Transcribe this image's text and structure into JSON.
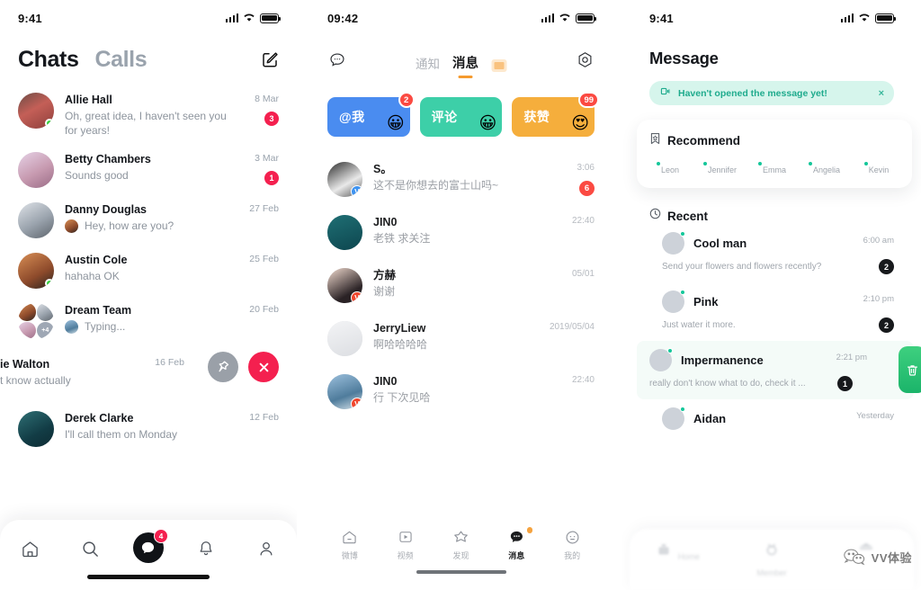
{
  "panel1": {
    "status": {
      "time": "9:41"
    },
    "tabs": [
      {
        "label": "Chats",
        "active": true
      },
      {
        "label": "Calls",
        "active": false
      }
    ],
    "compose_icon": "compose-icon",
    "chats": [
      {
        "name": "Allie Hall",
        "message": "Oh, great idea, I haven't seen you for years!",
        "time": "8 Mar",
        "badge": "3",
        "online": true
      },
      {
        "name": "Betty Chambers",
        "message": "Sounds good",
        "time": "3 Mar",
        "badge": "1",
        "online": false
      },
      {
        "name": "Danny Douglas",
        "message": "Hey, how are you?",
        "time": "27 Feb",
        "badge": "",
        "online": false,
        "mini_avatar": true
      },
      {
        "name": "Austin Cole",
        "message": "hahaha OK",
        "time": "25 Feb",
        "badge": "",
        "online": true
      },
      {
        "name": "Dream Team",
        "message": "Typing...",
        "time": "20 Feb",
        "badge": "",
        "online": false,
        "mini_avatar": true,
        "group": true,
        "group_more": "+4"
      },
      {
        "name": "ie Walton",
        "message": "t know actually",
        "time": "16 Feb",
        "badge": "",
        "swiped": true
      },
      {
        "name": "Derek Clarke",
        "message": "I'll call them on Monday",
        "time": "12 Feb",
        "badge": "",
        "online": false
      }
    ],
    "swipe_actions": [
      {
        "name": "pin-button",
        "icon": "pin-icon"
      },
      {
        "name": "delete-button",
        "icon": "close-icon"
      }
    ],
    "nav": [
      {
        "name": "home-icon",
        "active": false
      },
      {
        "name": "search-icon",
        "active": false
      },
      {
        "name": "chat-icon",
        "active": true,
        "badge": "4"
      },
      {
        "name": "bell-icon",
        "active": false
      },
      {
        "name": "profile-icon",
        "active": false
      }
    ]
  },
  "panel2": {
    "status": {
      "time": "09:42"
    },
    "header": {
      "left_icon": "chat-bubble-icon",
      "right_icon": "settings-icon",
      "tab_inactive": "通知",
      "tab_active": "消息"
    },
    "cards": [
      {
        "label": "@我",
        "badge": "2",
        "emoji": "😀",
        "color": "#4a8cf0"
      },
      {
        "label": "评论",
        "badge": "",
        "emoji": "😀",
        "color": "#3dcfa8"
      },
      {
        "label": "获赞",
        "badge": "99",
        "emoji": "😍",
        "color": "#f5ae3c"
      }
    ],
    "messages": [
      {
        "name": "S。",
        "text": "这不是你想去的富士山吗~",
        "time": "3:06",
        "badge": "6",
        "verified": "blue"
      },
      {
        "name": "JIN0",
        "text": "老铁 求关注",
        "time": "22:40",
        "badge": "",
        "verified": ""
      },
      {
        "name": "方赫",
        "text": "谢谢",
        "time": "05/01",
        "badge": "",
        "verified": "red"
      },
      {
        "name": "JerryLiew",
        "text": "啊哈哈哈哈",
        "time": "2019/05/04",
        "badge": "",
        "verified": ""
      },
      {
        "name": "JIN0",
        "text": "行 下次见哈",
        "time": "22:40",
        "badge": "",
        "verified": "red"
      }
    ],
    "nav": [
      {
        "label": "微博",
        "icon": "home-icon",
        "active": false
      },
      {
        "label": "视频",
        "icon": "video-icon",
        "active": false
      },
      {
        "label": "发现",
        "icon": "star-icon",
        "active": false
      },
      {
        "label": "消息",
        "icon": "message-icon",
        "active": true
      },
      {
        "label": "我的",
        "icon": "profile-icon",
        "active": false
      }
    ]
  },
  "panel3": {
    "status": {
      "time": "9:41"
    },
    "title": "Message",
    "banner": {
      "text": "Haven't opened the message yet!",
      "icon": "megaphone-icon",
      "close": "×",
      "bg": "#d6f5ec",
      "fg": "#1fab8d"
    },
    "recommend": {
      "heading": "Recommend",
      "icon": "bookmark-star-icon",
      "people": [
        {
          "name": "Leon"
        },
        {
          "name": "Jennifer"
        },
        {
          "name": "Emma"
        },
        {
          "name": "Angelia"
        },
        {
          "name": "Kevin"
        }
      ]
    },
    "recent": {
      "heading": "Recent",
      "icon": "clock-icon",
      "rows": [
        {
          "name": "Cool man",
          "message": "Send your flowers and flowers recently?",
          "time": "6:00 am",
          "badge": "2",
          "highlight": false
        },
        {
          "name": "Pink",
          "message": "Just water it more.",
          "time": "2:10 pm",
          "badge": "2",
          "highlight": false
        },
        {
          "name": "Impermanence",
          "message": "really don't know what to do, check it ...",
          "time": "2:21 pm",
          "badge": "1",
          "highlight": true,
          "trash_icon": "trash-icon"
        },
        {
          "name": "Aidan",
          "message": "",
          "time": "Yesterday",
          "badge": "",
          "highlight": false
        }
      ]
    },
    "nav": [
      {
        "label": "Home",
        "icon": "home-icon"
      },
      {
        "label": "Member",
        "icon": "member-icon"
      },
      {
        "label": "",
        "icon": "shop-icon"
      }
    ],
    "fab": {
      "icon": "chat-bubble-fab-icon"
    }
  },
  "watermark": {
    "text": "VV体验",
    "logo": "wechat-logo-icon"
  }
}
